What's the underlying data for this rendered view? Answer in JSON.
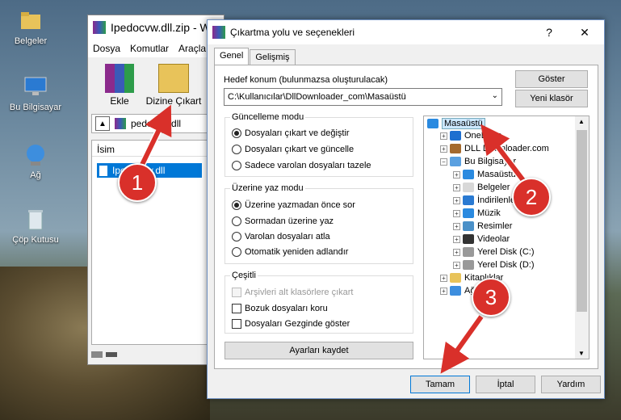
{
  "desktop": {
    "icons": [
      {
        "label": "Belgeler"
      },
      {
        "label": "Bu Bilgisayar"
      },
      {
        "label": "Ağ"
      },
      {
        "label": "Çöp Kutusu"
      }
    ]
  },
  "back_window": {
    "title": "Ipedocvw.dll.zip - W",
    "menu": [
      "Dosya",
      "Komutlar",
      "Araçla"
    ],
    "tools": [
      "Ekle",
      "Dizine Çıkart"
    ],
    "path": "pedocvw.dll",
    "list_header": "İsim",
    "list_item": "Ipedocvw.dll"
  },
  "dialog": {
    "title": "Çıkartma yolu ve seçenekleri",
    "help": "?",
    "close": "✕",
    "tabs": [
      "Genel",
      "Gelişmiş"
    ],
    "dest_label": "Hedef konum (bulunmazsa oluşturulacak)",
    "dest_value": "C:\\Kullanıcılar\\DllDownloader_com\\Masaüstü",
    "show_button": "Göster",
    "new_folder_button": "Yeni klasör",
    "update_mode": {
      "title": "Güncelleme modu",
      "options": [
        "Dosyaları çıkart ve değiştir",
        "Dosyaları çıkart ve güncelle",
        "Sadece varolan dosyaları tazele"
      ],
      "selected": 0
    },
    "overwrite_mode": {
      "title": "Üzerine yaz modu",
      "options": [
        "Üzerine yazmadan önce sor",
        "Sormadan üzerine yaz",
        "Varolan dosyaları atla",
        "Otomatik yeniden adlandır"
      ],
      "selected": 0
    },
    "misc": {
      "title": "Çeşitli",
      "options": [
        "Arşivleri alt klasörlere çıkart",
        "Bozuk dosyaları koru",
        "Dosyaları Gezginde göster"
      ]
    },
    "save_button": "Ayarları kaydet",
    "tree": [
      {
        "label": "Masaüstü",
        "level": 0,
        "icon": "desktop-icon",
        "selected": true
      },
      {
        "label": "OneDrive",
        "level": 1,
        "icon": "cloud-icon",
        "expander": "+"
      },
      {
        "label": "DLL Downloader.com",
        "level": 1,
        "icon": "user-icon",
        "expander": "+"
      },
      {
        "label": "Bu Bilgisayar",
        "level": 1,
        "icon": "computer-icon",
        "expander": "−"
      },
      {
        "label": "Masaüstü",
        "level": 2,
        "icon": "desktop-icon",
        "expander": "+"
      },
      {
        "label": "Belgeler",
        "level": 2,
        "icon": "documents-icon",
        "expander": "+"
      },
      {
        "label": "İndirilenler",
        "level": 2,
        "icon": "download-icon",
        "expander": "+"
      },
      {
        "label": "Müzik",
        "level": 2,
        "icon": "music-icon",
        "expander": "+"
      },
      {
        "label": "Resimler",
        "level": 2,
        "icon": "pictures-icon",
        "expander": "+"
      },
      {
        "label": "Videolar",
        "level": 2,
        "icon": "video-icon",
        "expander": "+"
      },
      {
        "label": "Yerel Disk (C:)",
        "level": 2,
        "icon": "disk-icon",
        "expander": "+"
      },
      {
        "label": "Yerel Disk (D:)",
        "level": 2,
        "icon": "disk-icon",
        "expander": "+"
      },
      {
        "label": "Kitaplıklar",
        "level": 1,
        "icon": "library-icon",
        "expander": "+"
      },
      {
        "label": "Ağ",
        "level": 1,
        "icon": "network-icon",
        "expander": "+"
      }
    ],
    "ok_button": "Tamam",
    "cancel_button": "İptal",
    "help_button": "Yardım"
  },
  "badges": [
    "1",
    "2",
    "3"
  ],
  "colors": {
    "badge": "#d9302a",
    "selection": "#cce8ff",
    "accent": "#0078d7"
  }
}
